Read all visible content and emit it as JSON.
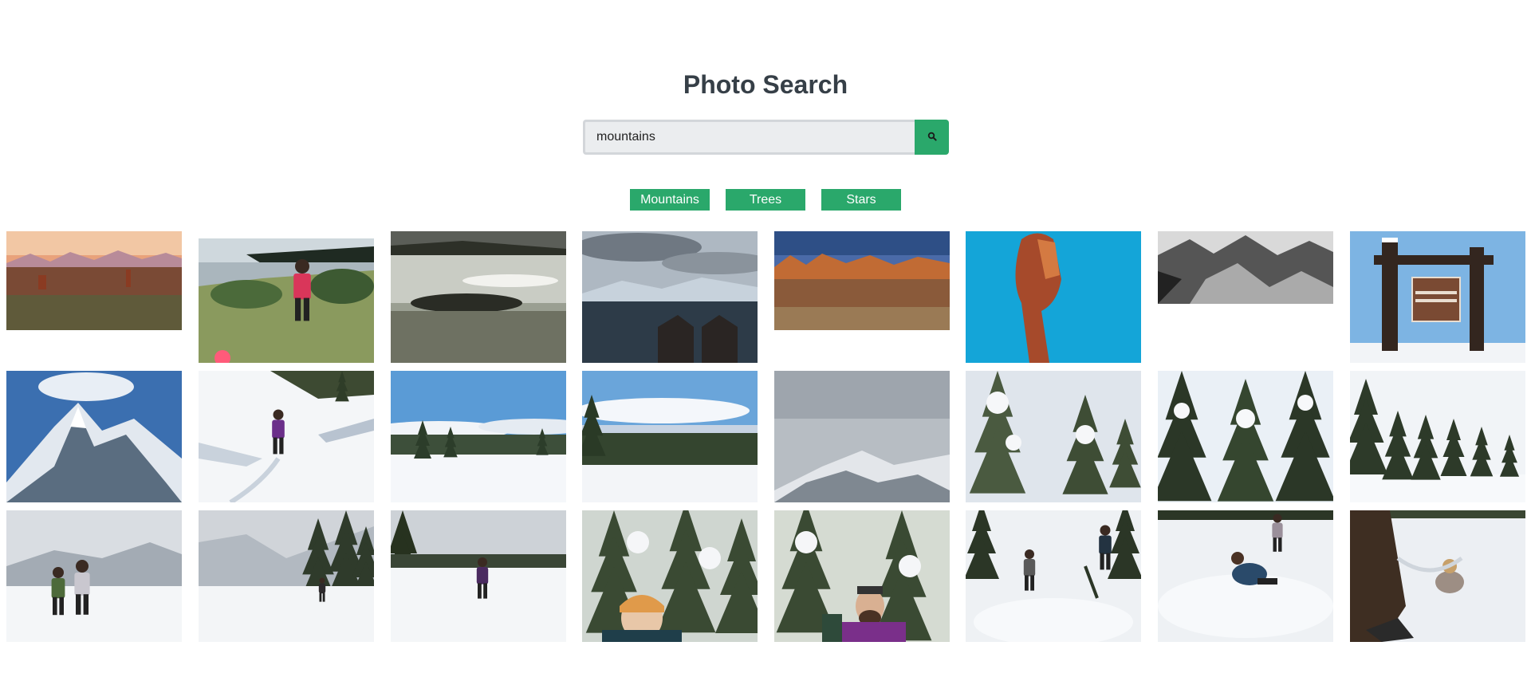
{
  "header": {
    "title": "Photo Search"
  },
  "search": {
    "value": "mountains",
    "placeholder": "",
    "button_icon": "search-icon"
  },
  "filters": [
    {
      "label": "Mountains"
    },
    {
      "label": "Trees"
    },
    {
      "label": "Stars"
    }
  ],
  "colors": {
    "accent": "#2aa86b",
    "title": "#363f47",
    "input_bg": "#ebedef"
  },
  "photos": [
    {
      "name": "photo-desert-sunrise-mountains",
      "kind": "desert-sunrise"
    },
    {
      "name": "photo-hiker-pink-jacket-shoreline",
      "kind": "hiker-shore"
    },
    {
      "name": "photo-lake-island-silver",
      "kind": "lake-silver"
    },
    {
      "name": "photo-chimneys-lake-mountains",
      "kind": "chimneys-lake"
    },
    {
      "name": "photo-red-rock-canyon",
      "kind": "red-rock"
    },
    {
      "name": "photo-balanced-rock-blue-sky",
      "kind": "balanced-rock"
    },
    {
      "name": "photo-black-white-mountain-valley",
      "kind": "bw-mountains"
    },
    {
      "name": "photo-grand-teton-sign",
      "kind": "teton-sign"
    },
    {
      "name": "photo-snowy-peak-blue-sky",
      "kind": "snowy-peak"
    },
    {
      "name": "photo-snowshoer-open-field",
      "kind": "snowshoer-field"
    },
    {
      "name": "photo-snowy-meadow-pines",
      "kind": "snow-meadow"
    },
    {
      "name": "photo-snow-field-clouds",
      "kind": "snow-field-clouds"
    },
    {
      "name": "photo-misty-mountain",
      "kind": "misty-mountain"
    },
    {
      "name": "photo-snow-covered-pines",
      "kind": "snow-pines"
    },
    {
      "name": "photo-tall-snowy-pines",
      "kind": "tall-pines"
    },
    {
      "name": "photo-pine-forest-edge",
      "kind": "forest-edge"
    },
    {
      "name": "photo-two-hikers-snow",
      "kind": "two-hikers"
    },
    {
      "name": "photo-snowy-trail-hiker",
      "kind": "trail-hiker"
    },
    {
      "name": "photo-hiker-snowy-lake",
      "kind": "hiker-lake"
    },
    {
      "name": "photo-hiker-orange-hat",
      "kind": "orange-hat"
    },
    {
      "name": "photo-bearded-hiker-purple",
      "kind": "bearded-hiker"
    },
    {
      "name": "photo-hikers-deep-snow",
      "kind": "deep-snow"
    },
    {
      "name": "photo-hiker-fallen-snow",
      "kind": "fallen-snow"
    },
    {
      "name": "photo-hiker-legs-snow",
      "kind": "legs-snow"
    }
  ]
}
